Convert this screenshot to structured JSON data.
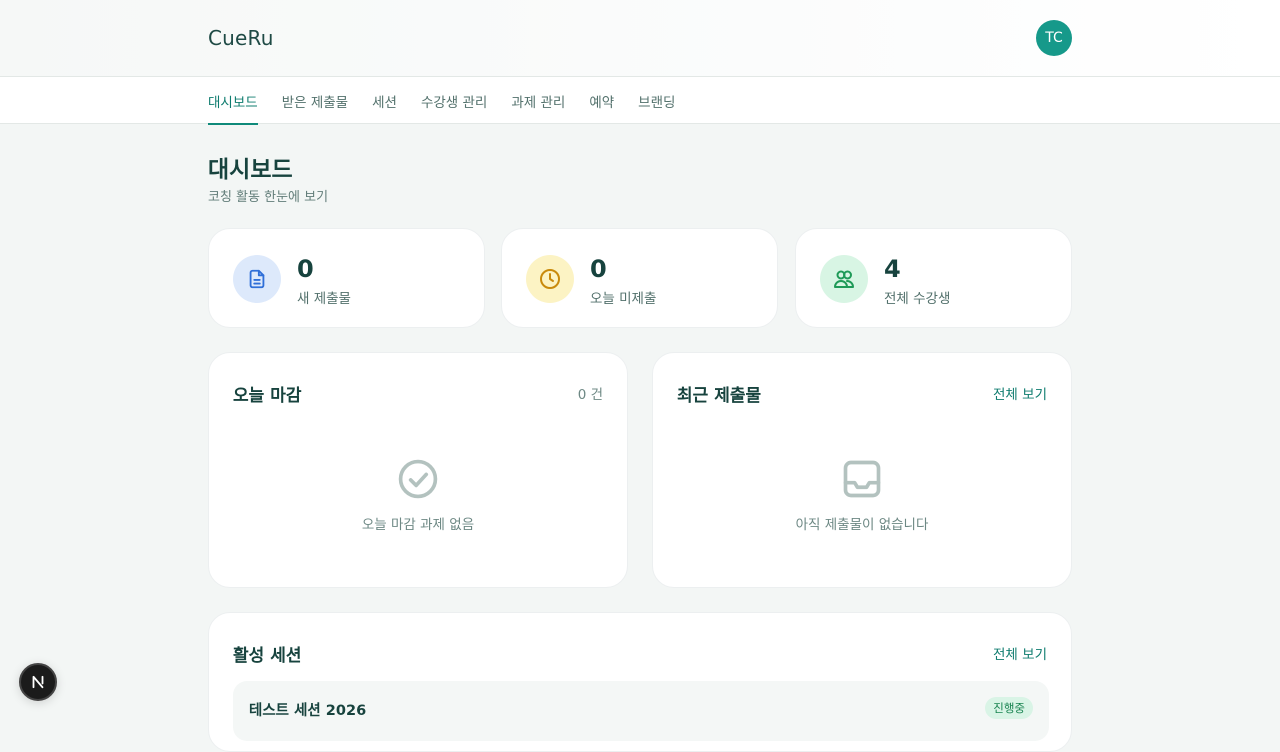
{
  "app": {
    "logo": "CueRu",
    "avatar_initials": "TC"
  },
  "nav": {
    "tabs": [
      {
        "label": "대시보드",
        "active": true
      },
      {
        "label": "받은 제출물",
        "active": false
      },
      {
        "label": "세션",
        "active": false
      },
      {
        "label": "수강생 관리",
        "active": false
      },
      {
        "label": "과제 관리",
        "active": false
      },
      {
        "label": "예약",
        "active": false
      },
      {
        "label": "브랜딩",
        "active": false
      }
    ]
  },
  "page": {
    "title": "대시보드",
    "subtitle": "코칭 활동 한눈에 보기"
  },
  "stats": [
    {
      "value": "0",
      "label": "새 제출물",
      "icon": "document-icon",
      "bg": "#dde9fb",
      "color": "#2f6fd8"
    },
    {
      "value": "0",
      "label": "오늘 미제출",
      "icon": "clock-icon",
      "bg": "#fcf3c4",
      "color": "#c98a0c"
    },
    {
      "value": "4",
      "label": "전체 수강생",
      "icon": "users-icon",
      "bg": "#d8f5e4",
      "color": "#1f9a58"
    }
  ],
  "today_deadline": {
    "title": "오늘 마감",
    "count": "0 건",
    "empty_text": "오늘 마감 과제 없음",
    "icon": "check-circle-icon"
  },
  "recent_submissions": {
    "title": "최근 제출물",
    "link": "전체 보기",
    "empty_text": "아직 제출물이 없습니다",
    "icon": "inbox-icon"
  },
  "active_sessions": {
    "title": "활성 세션",
    "link": "전체 보기",
    "sessions": [
      {
        "name": "테스트 세션 2026",
        "status": "진행중"
      }
    ]
  },
  "colors": {
    "accent": "#0f8a7a",
    "avatar": "#16998a",
    "page_bg": "#f3f6f5"
  }
}
